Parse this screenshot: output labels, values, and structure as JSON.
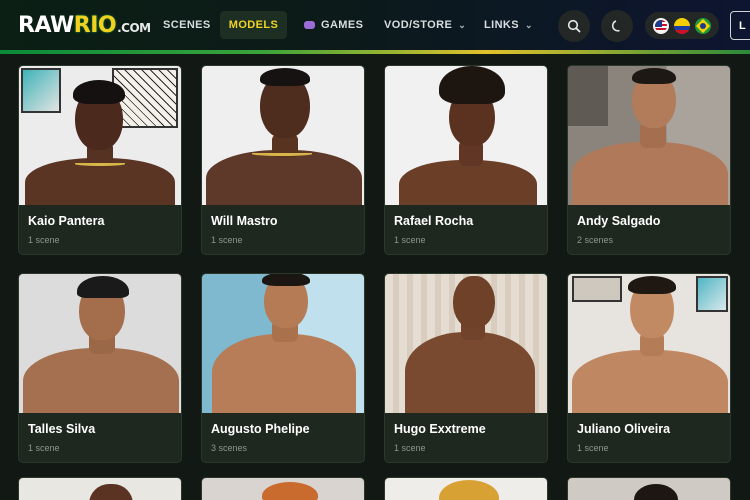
{
  "header": {
    "logo": {
      "raw": "RAW",
      "rio": "RIO",
      "com": ".COM"
    },
    "nav": [
      {
        "label": "SCENES",
        "active": false
      },
      {
        "label": "MODELS",
        "active": true
      },
      {
        "label": "GAMES",
        "active": false,
        "icon": "gamepad-icon"
      },
      {
        "label": "VOD/STORE",
        "active": false,
        "dropdown": true
      },
      {
        "label": "LINKS",
        "active": false,
        "dropdown": true
      }
    ],
    "search_icon": "search-icon",
    "theme_icon": "moon-icon",
    "languages": [
      "us-flag",
      "colombia-flag",
      "brazil-flag"
    ],
    "login_label": "L"
  },
  "colors": {
    "accent": "#f0d326",
    "card_bg": "#1f281f",
    "page_bg": "#121814",
    "stripe": [
      "#0a8a3a",
      "#e3c22a"
    ]
  },
  "models": [
    {
      "name": "Kaio Pantera",
      "scenes": "1 scene"
    },
    {
      "name": "Will Mastro",
      "scenes": "1 scene"
    },
    {
      "name": "Rafael Rocha",
      "scenes": "1 scene"
    },
    {
      "name": "Andy Salgado",
      "scenes": "2 scenes"
    },
    {
      "name": "Talles Silva",
      "scenes": "1 scene"
    },
    {
      "name": "Augusto Phelipe",
      "scenes": "3 scenes"
    },
    {
      "name": "Hugo Exxtreme",
      "scenes": "1 scene"
    },
    {
      "name": "Juliano Oliveira",
      "scenes": "1 scene"
    }
  ]
}
